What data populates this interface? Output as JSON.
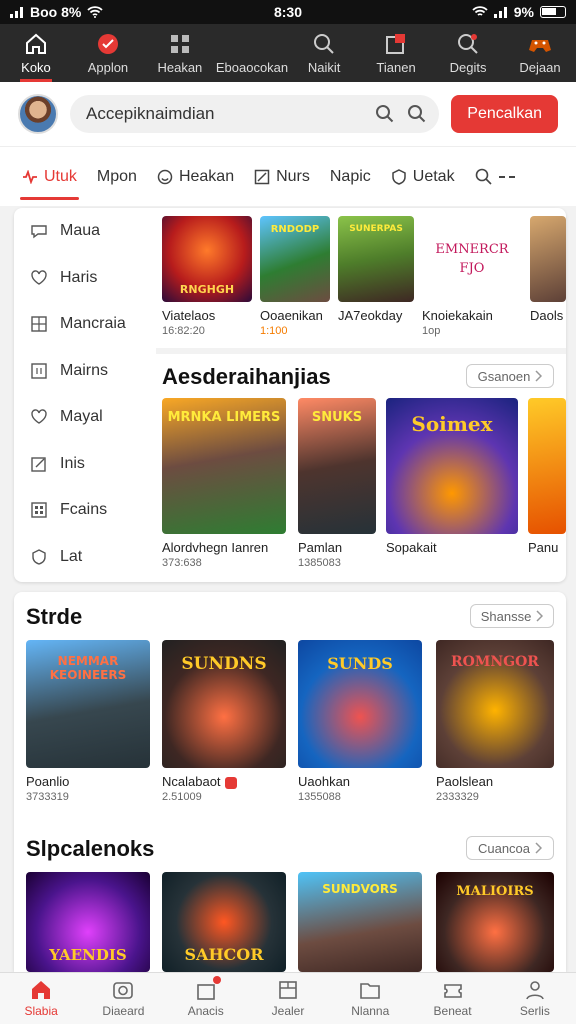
{
  "status_bar": {
    "carrier": "Boo 8%",
    "time": "8:30",
    "battery": "9%"
  },
  "top_nav": [
    {
      "label": "Koko",
      "icon": "home-icon",
      "active": true
    },
    {
      "label": "Applon",
      "icon": "app-icon",
      "active": false
    },
    {
      "label": "Heakan",
      "icon": "grid-icon",
      "active": false
    },
    {
      "label": "Eboaocokan",
      "icon": "category-icon",
      "active": false
    },
    {
      "label": "Naikit",
      "icon": "search-icon",
      "active": false
    },
    {
      "label": "Tianen",
      "icon": "notification-icon",
      "active": false
    },
    {
      "label": "Degits",
      "icon": "search-alert-icon",
      "active": false
    },
    {
      "label": "Dejaan",
      "icon": "controller-icon",
      "active": false
    }
  ],
  "search": {
    "value": "Accepiknaimdian",
    "button_label": "Pencalkan"
  },
  "tabs": [
    {
      "label": "Utuk",
      "active": true
    },
    {
      "label": "Mpon"
    },
    {
      "label": "Heakan"
    },
    {
      "label": "Nurs"
    },
    {
      "label": "Napic"
    },
    {
      "label": "Uetak"
    }
  ],
  "categories": [
    {
      "label": "Maua",
      "icon": "chat-icon"
    },
    {
      "label": "Haris",
      "icon": "heart-icon"
    },
    {
      "label": "Mancraia",
      "icon": "grid-icon"
    },
    {
      "label": "Mairns",
      "icon": "frame-icon"
    },
    {
      "label": "Mayal",
      "icon": "heart-icon"
    },
    {
      "label": "Inis",
      "icon": "edit-icon"
    },
    {
      "label": "Fcains",
      "icon": "apps-icon"
    },
    {
      "label": "Lat",
      "icon": "shield-icon"
    }
  ],
  "strip1": [
    {
      "title": "Viatelaos",
      "sub": "16:82:20",
      "art_text": "RNGHGH"
    },
    {
      "title": "Ooaenikan",
      "sub": "1:100",
      "art_text": "RNDODP"
    },
    {
      "title": "JA7eokday",
      "sub": "",
      "art_text": "SUNERPAS"
    },
    {
      "title": "Knoiekakain",
      "sub": "1op",
      "art_text": "EMNERCR FJO"
    },
    {
      "title": "Daols",
      "sub": "",
      "art_text": ""
    }
  ],
  "section1": {
    "title": "Aesderaihanjias",
    "see_all": "Gsanoen",
    "items": [
      {
        "title": "Alordvhegn Ianren",
        "sub": "373:638",
        "art_text": "MRNKA LIMERS"
      },
      {
        "title": "Pamlan",
        "sub": "1385083",
        "art_text": "SNUKS"
      },
      {
        "title": "Sopakait",
        "sub": "",
        "art_text": "Soimex"
      },
      {
        "title": "Panu",
        "sub": "",
        "art_text": ""
      }
    ]
  },
  "section2": {
    "title": "Strde",
    "see_all": "Shansse",
    "items": [
      {
        "title": "Poanlio",
        "sub": "3733319",
        "art_text": "NEMMAR KEOINEERS"
      },
      {
        "title": "Ncalabaot",
        "sub": "2.51009",
        "art_text": "SUNDNS"
      },
      {
        "title": "Uaohkan",
        "sub": "1355088",
        "art_text": "SUNDS"
      },
      {
        "title": "Paolslean",
        "sub": "2333329",
        "art_text": "ROMNGOR"
      }
    ]
  },
  "section3": {
    "title": "Slpcalenoks",
    "see_all": "Cuancoa",
    "items": [
      {
        "title": "",
        "art_text": "YAENDIS"
      },
      {
        "title": "",
        "art_text": "SAHCOR"
      },
      {
        "title": "",
        "art_text": "SUNDVORS"
      },
      {
        "title": "",
        "art_text": "MALIOIRS"
      }
    ]
  },
  "bottom_nav": [
    {
      "label": "Slabia",
      "icon": "home-icon",
      "active": true
    },
    {
      "label": "Diaeard",
      "icon": "camera-icon"
    },
    {
      "label": "Anacis",
      "icon": "bag-icon"
    },
    {
      "label": "Jealer",
      "icon": "box-icon"
    },
    {
      "label": "Nlanna",
      "icon": "folder-icon"
    },
    {
      "label": "Beneat",
      "icon": "ticket-icon"
    },
    {
      "label": "Serlis",
      "icon": "user-icon"
    }
  ],
  "colors": {
    "accent": "#e53935",
    "header": "#2a2a2a"
  }
}
